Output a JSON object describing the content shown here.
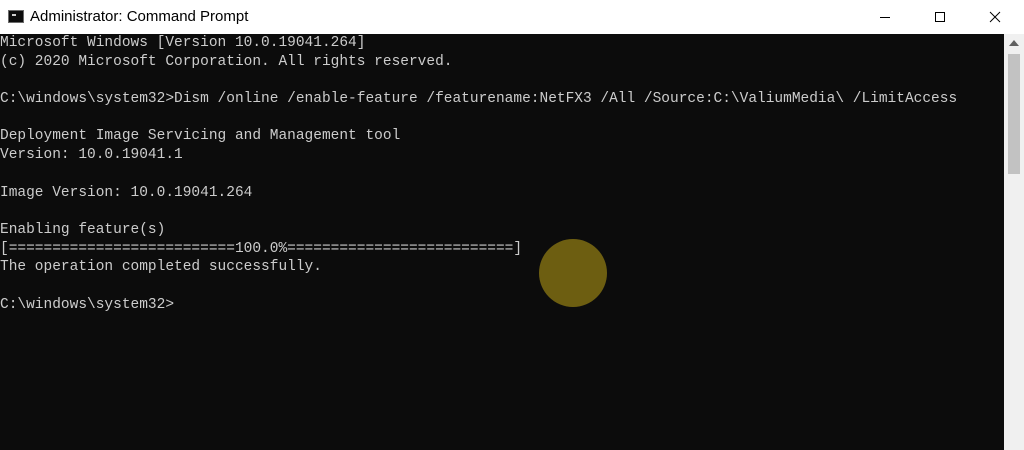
{
  "window": {
    "title": "Administrator: Command Prompt"
  },
  "icons": {
    "app": "command-prompt-icon",
    "minimize": "minimize-icon",
    "maximize": "maximize-icon",
    "close": "close-icon",
    "scroll_up": "scroll-up-arrow-icon"
  },
  "console": {
    "lines": [
      "Microsoft Windows [Version 10.0.19041.264]",
      "(c) 2020 Microsoft Corporation. All rights reserved.",
      "",
      "C:\\windows\\system32>Dism /online /enable-feature /featurename:NetFX3 /All /Source:C:\\ValiumMedia\\ /LimitAccess",
      "",
      "Deployment Image Servicing and Management tool",
      "Version: 10.0.19041.1",
      "",
      "Image Version: 10.0.19041.264",
      "",
      "Enabling feature(s)",
      "[==========================100.0%==========================]",
      "The operation completed successfully.",
      "",
      "C:\\windows\\system32>"
    ]
  },
  "colors": {
    "console_background": "#0c0c0c",
    "console_text": "#cccccc",
    "titlebar_background": "#ffffff",
    "cursor_highlight": "#766612"
  }
}
